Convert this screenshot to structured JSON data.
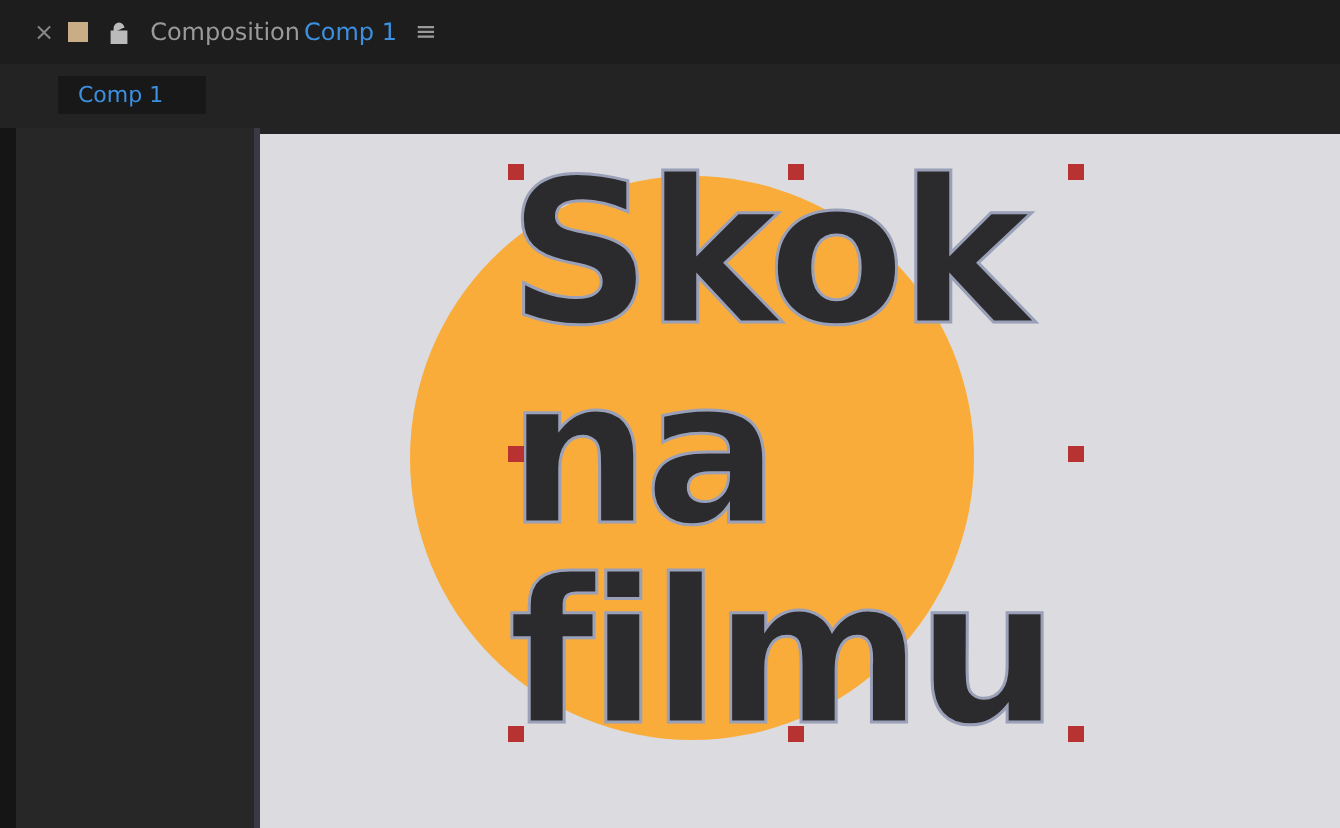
{
  "panel": {
    "close": "×",
    "title_prefix": "Composition",
    "title_comp": "Comp 1",
    "menu": "≡"
  },
  "tabs": [
    {
      "label": "Comp 1",
      "selected": true
    }
  ],
  "canvas": {
    "lines": [
      "Skok",
      "na",
      "filmu"
    ]
  }
}
